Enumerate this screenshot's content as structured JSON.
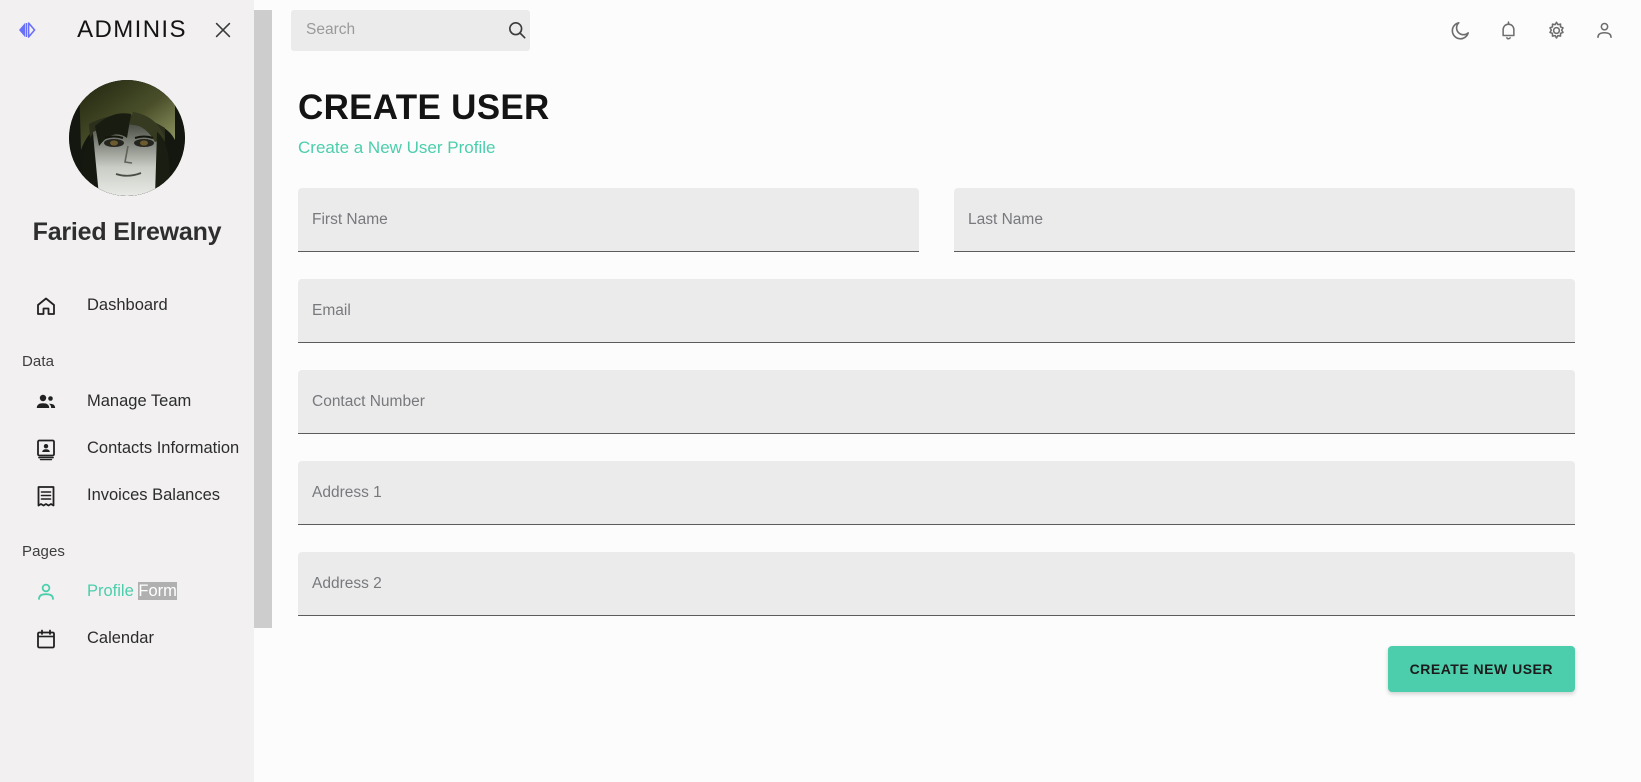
{
  "sidebar": {
    "brand": "ADMINIS",
    "collapse_icon": "collapse-arrows-icon",
    "close_icon": "close-icon",
    "profile": {
      "name": "Faried Elrewany",
      "avatar_alt": "user-avatar"
    },
    "groups": [
      {
        "section": null,
        "items": [
          {
            "icon": "home-icon",
            "label": "Dashboard",
            "active": false
          }
        ]
      },
      {
        "section": "Data",
        "items": [
          {
            "icon": "people-icon",
            "label": "Manage Team",
            "active": false
          },
          {
            "icon": "contacts-icon",
            "label": "Contacts Information",
            "active": false
          },
          {
            "icon": "receipt-icon",
            "label": "Invoices Balances",
            "active": false
          }
        ]
      },
      {
        "section": "Pages",
        "items": [
          {
            "icon": "person-outline-icon",
            "label": "Profile ",
            "label_selected": "Form",
            "active": true
          },
          {
            "icon": "calendar-icon",
            "label": "Calendar",
            "active": false
          }
        ]
      }
    ]
  },
  "topbar": {
    "search": {
      "placeholder": "Search",
      "value": "",
      "icon": "search-icon"
    },
    "actions": [
      {
        "icon": "dark-mode-moon-icon",
        "name": "dark-mode-toggle"
      },
      {
        "icon": "notifications-bell-icon",
        "name": "notifications-button"
      },
      {
        "icon": "settings-gear-icon",
        "name": "settings-button"
      },
      {
        "icon": "person-icon",
        "name": "profile-button"
      }
    ]
  },
  "main": {
    "title": "CREATE USER",
    "subtitle": "Create a New User Profile",
    "fields": {
      "first_name": {
        "label": "First Name",
        "value": ""
      },
      "last_name": {
        "label": "Last Name",
        "value": ""
      },
      "email": {
        "label": "Email",
        "value": ""
      },
      "contact_number": {
        "label": "Contact Number",
        "value": ""
      },
      "address1": {
        "label": "Address 1",
        "value": ""
      },
      "address2": {
        "label": "Address 2",
        "value": ""
      }
    },
    "submit_label": "CREATE NEW USER"
  },
  "colors": {
    "accent_green": "#4cceac",
    "sidebar_bg": "#f2f0f0",
    "field_bg": "#ebebeb",
    "collapse_icon_blue": "#6870fa"
  }
}
